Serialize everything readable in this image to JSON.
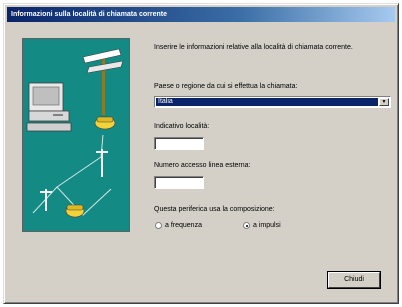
{
  "window": {
    "title": "Informazioni sulla località di chiamata corrente"
  },
  "intro_text": "Inserire le informazioni relative alla località di chiamata corrente.",
  "country": {
    "label": "Paese o regione da cui si effettua la chiamata:",
    "value": "Italia"
  },
  "area_code": {
    "label": "Indicativo località:",
    "value": ""
  },
  "outside_line": {
    "label": "Numero accesso linea esterna:",
    "value": ""
  },
  "dialing": {
    "label": "Questa periferica usa la composizione:",
    "options": [
      {
        "label": "a frequenza",
        "selected": false
      },
      {
        "label": "a impulsi",
        "selected": true
      }
    ]
  },
  "buttons": {
    "close": "Chiudi"
  },
  "colors": {
    "dialog_bg": "#d4d0c8",
    "title_bar": "#0a246a",
    "illustration_bg": "#138a84",
    "selection": "#0a246a"
  }
}
